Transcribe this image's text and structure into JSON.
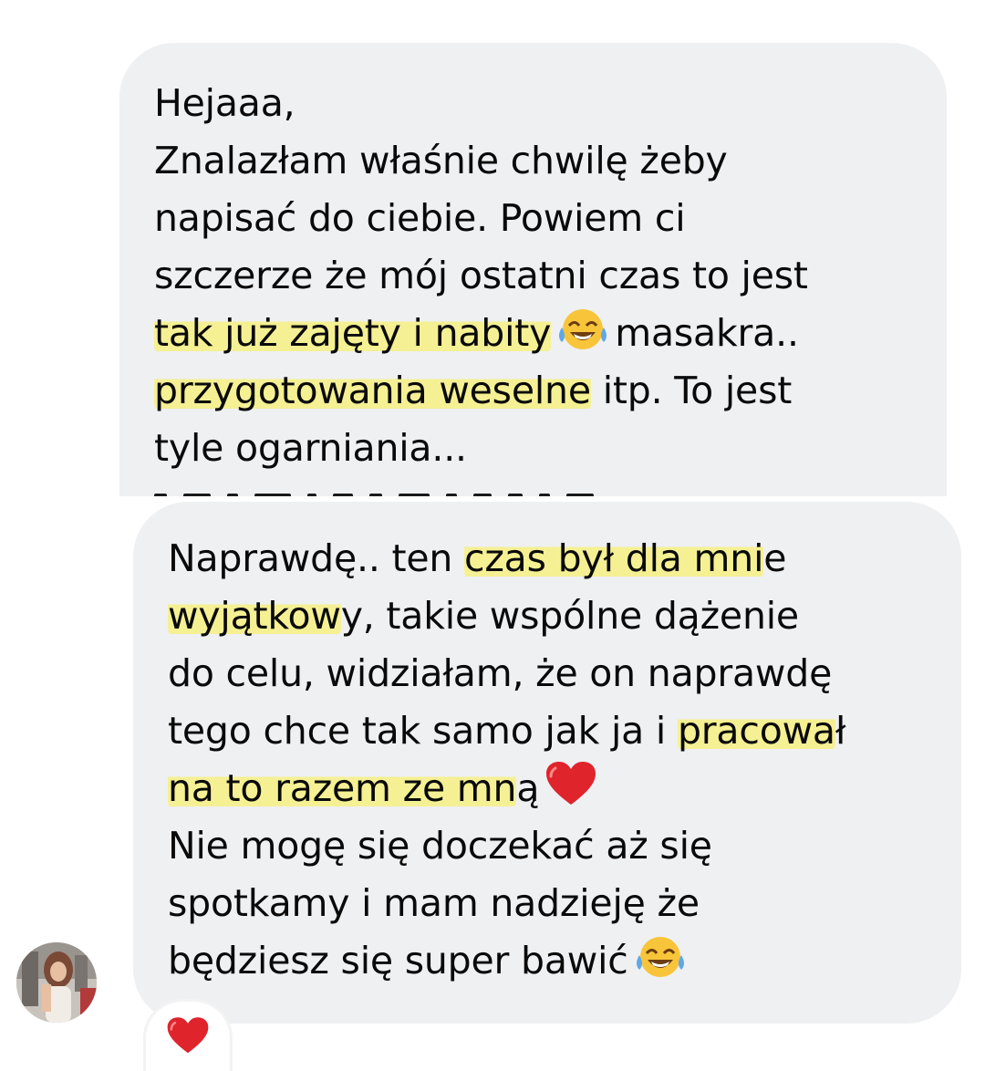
{
  "messages": [
    {
      "lines": {
        "l1": "Hejaaa,",
        "l2": "Znalazłam właśnie chwilę żeby",
        "l3": "napisać do ciebie. Powiem ci",
        "l4": "szczerze że mój ostatni czas to jest",
        "l5a": "tak już zajęty i nabity",
        "l5b": "masakra..",
        "l6a": "przygotowania weselne",
        "l6b": " itp. To jest",
        "l7": "tyle ogarniania..."
      },
      "emoji": "face-with-tears-of-joy-icon",
      "truncated": true
    },
    {
      "lines": {
        "l1a": "Naprawdę.. ten ",
        "l1b": "czas był dla mni",
        "l1c": "e",
        "l2a": "wyjątkow",
        "l2b": "y, takie wspólne dążenie",
        "l3": "do celu, widziałam, że on naprawdę",
        "l4a": "tego chce tak samo jak ja i ",
        "l4b": "pracowa",
        "l4c": "ł",
        "l5a": "na to razem ze mn",
        "l5b": "ą",
        "l6": "Nie mogę się doczekać aż się",
        "l7": "spotkamy i mam nadzieję że",
        "l8": "będziesz się super bawić"
      },
      "emojis": [
        "red-heart-icon",
        "face-with-tears-of-joy-icon"
      ]
    }
  ],
  "reaction": "red-heart-icon",
  "colors": {
    "bubble": "#eff0f2",
    "highlight": "#f6f082",
    "text": "#0a0a0a",
    "heart": "#e0242c",
    "emoji_face": "#f8c53a"
  }
}
